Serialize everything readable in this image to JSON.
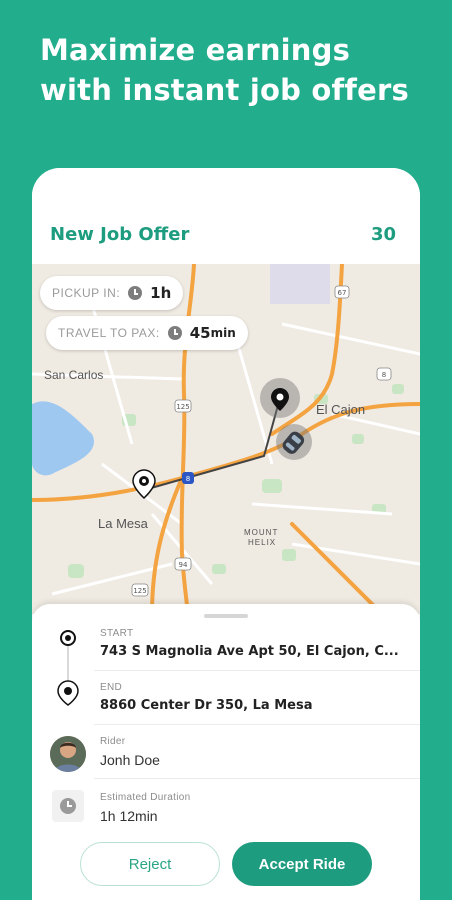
{
  "promo": {
    "headline_line1": "Maximize earnings",
    "headline_line2": "with instant job offers"
  },
  "header": {
    "title": "New Job Offer",
    "countdown": "30"
  },
  "map": {
    "pickup": {
      "label": "PICKUP IN:",
      "value": "1h",
      "icon": "clock-icon"
    },
    "travel": {
      "label": "TRAVEL TO PAX:",
      "value": "45",
      "unit": "min",
      "icon": "clock-icon"
    },
    "place_labels": [
      "San Carlos",
      "El Cajon",
      "La Mesa",
      "MOUNT",
      "HELIX"
    ],
    "highway_shields": [
      "67",
      "8",
      "125",
      "94",
      "8",
      "125"
    ]
  },
  "trip": {
    "start": {
      "label": "START",
      "value": "743 S Magnolia Ave Apt 50, El Cajon, C..."
    },
    "end": {
      "label": "END",
      "value": "8860 Center Dr 350, La Mesa"
    },
    "rider": {
      "label": "Rider",
      "value": "Jonh Doe",
      "icon": "avatar"
    },
    "duration": {
      "label": "Estimated Duration",
      "value": "1h 12min",
      "icon": "clock-icon"
    }
  },
  "actions": {
    "reject_label": "Reject",
    "accept_label": "Accept Ride"
  },
  "colors": {
    "brand": "#22ad8c",
    "accent": "#1d9c7f",
    "highway": "#f4a341"
  }
}
